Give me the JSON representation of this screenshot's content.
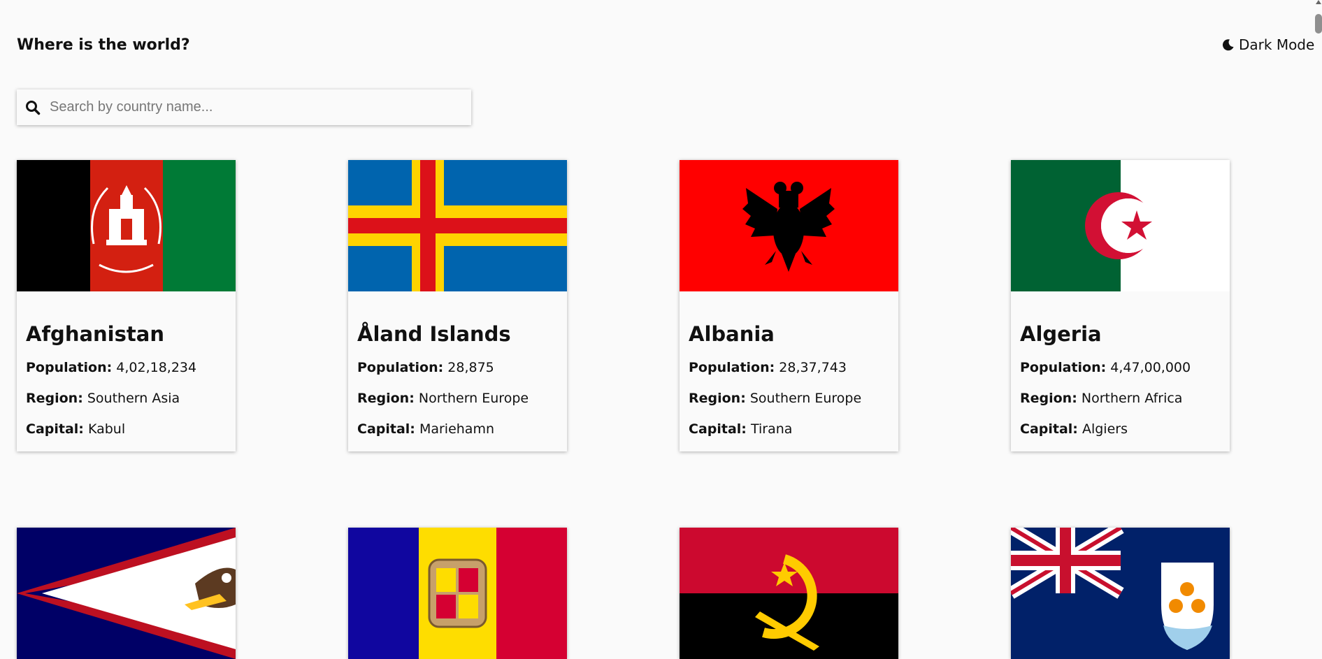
{
  "header": {
    "title": "Where is the world?",
    "mode_label": "Dark Mode"
  },
  "search": {
    "placeholder": "Search by country name...",
    "value": ""
  },
  "labels": {
    "population": "Population:",
    "region": "Region:",
    "capital": "Capital:"
  },
  "countries": [
    {
      "name": "Afghanistan",
      "population": "4,02,18,234",
      "region": "Southern Asia",
      "capital": "Kabul"
    },
    {
      "name": "Åland Islands",
      "population": "28,875",
      "region": "Northern Europe",
      "capital": "Mariehamn"
    },
    {
      "name": "Albania",
      "population": "28,37,743",
      "region": "Southern Europe",
      "capital": "Tirana"
    },
    {
      "name": "Algeria",
      "population": "4,47,00,000",
      "region": "Northern Africa",
      "capital": "Algiers"
    }
  ],
  "colors": {
    "background": "#fafafa",
    "text": "#111111"
  },
  "icons": {
    "mode": "moon-icon",
    "search": "search-icon"
  }
}
